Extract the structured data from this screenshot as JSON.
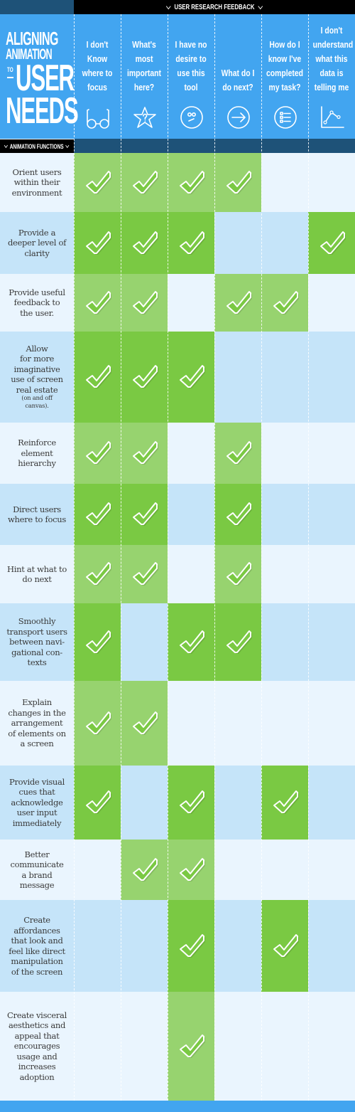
{
  "top_bar": {
    "title": "USER RESEARCH FEEDBACK"
  },
  "logo": {
    "line1": "ALIGNING",
    "line2": "ANIMATION",
    "to": "TO",
    "line3": "USER",
    "line4": "NEEDS"
  },
  "functions_label": "ANIMATION FUNCTIONS",
  "colors": {
    "header_blue": "#42a5f0",
    "dark_blue": "#1e5278",
    "row_light": "#eaf5fe",
    "row_blue": "#c5e4f9",
    "check_light_green": "#97d36f",
    "check_dark_green": "#7ac943"
  },
  "chart_data": {
    "type": "table",
    "title": "Aligning Animation to User Needs",
    "column_group_label": "User Research Feedback",
    "row_group_label": "Animation Functions",
    "columns": [
      {
        "label": "I don't\nKnow\nwhere to\nfocus",
        "icon": "glasses-icon"
      },
      {
        "label": "What's\nmost\nimportant\nhere?",
        "icon": "star-question-icon"
      },
      {
        "label": "I have no\ndesire to\nuse this\ntool",
        "icon": "confused-face-icon"
      },
      {
        "label": "What do I\ndo next?",
        "icon": "arrow-right-circle-icon"
      },
      {
        "label": "How do I\nknow I've\ncompleted\nmy task?",
        "icon": "checklist-circle-icon"
      },
      {
        "label": "I don't\nunderstand\nwhat this\ndata is\ntelling me",
        "icon": "line-graph-icon"
      }
    ],
    "rows": [
      {
        "label": "Orient users\nwithin their\nenvironment",
        "checks": [
          true,
          true,
          true,
          true,
          false,
          false
        ]
      },
      {
        "label": "Provide a\ndeeper level of\nclarity",
        "checks": [
          true,
          true,
          true,
          false,
          false,
          true
        ]
      },
      {
        "label": "Provide useful\nfeedback to\nthe user.",
        "checks": [
          true,
          true,
          false,
          true,
          true,
          false
        ]
      },
      {
        "label": "Allow\nfor more\nimaginative\nuse of screen\nreal estate",
        "note": "(on and off\ncanvas).",
        "checks": [
          true,
          true,
          true,
          false,
          false,
          false
        ]
      },
      {
        "label": "Reinforce\nelement\nhierarchy",
        "checks": [
          true,
          true,
          false,
          true,
          false,
          false
        ]
      },
      {
        "label": "Direct users\nwhere to focus",
        "checks": [
          true,
          true,
          false,
          true,
          false,
          false
        ]
      },
      {
        "label": "Hint at what to\ndo next",
        "checks": [
          true,
          true,
          false,
          true,
          false,
          false
        ]
      },
      {
        "label": "Smoothly\ntransport users\nbetween navi-\ngational con-\ntexts",
        "checks": [
          true,
          false,
          true,
          true,
          false,
          false
        ]
      },
      {
        "label": "Explain\nchanges in the\narrangement\nof elements on\na screen",
        "checks": [
          true,
          true,
          false,
          false,
          false,
          false
        ]
      },
      {
        "label": "Provide visual\ncues that\nacknowledge\nuser input\nimmediately",
        "checks": [
          true,
          false,
          true,
          false,
          true,
          false
        ]
      },
      {
        "label": "Better\ncommunicate\na brand\nmessage",
        "checks": [
          false,
          true,
          true,
          false,
          false,
          false
        ]
      },
      {
        "label": "Create\naffordances\nthat look and\nfeel like direct\nmanipulation\nof the screen",
        "checks": [
          false,
          false,
          true,
          false,
          true,
          false
        ]
      },
      {
        "label": "Create visceral\naesthetics and\nappeal that\nencourages\nusage and\nincreases\nadoption",
        "checks": [
          false,
          false,
          true,
          false,
          false,
          false
        ]
      }
    ]
  }
}
